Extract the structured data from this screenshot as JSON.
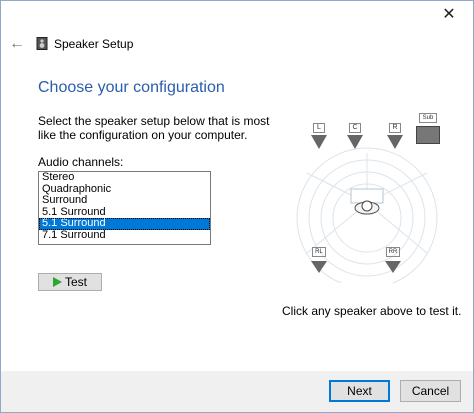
{
  "window": {
    "title": "Speaker Setup",
    "close_glyph": "✕",
    "back_glyph": "←"
  },
  "main": {
    "heading": "Choose your configuration",
    "description": "Select the speaker setup below that is most like the configuration on your computer.",
    "channels_label": "Audio channels:",
    "channels": [
      "Stereo",
      "Quadraphonic",
      "Surround",
      "5.1 Surround",
      "5.1 Surround",
      "7.1 Surround"
    ],
    "selected_index": 4,
    "test_label": "Test",
    "hint": "Click any speaker above to test it."
  },
  "speakers": {
    "front_left": "L",
    "center": "C",
    "front_right": "R",
    "subwoofer": "Sub",
    "rear_left": "RL",
    "rear_right": "RR"
  },
  "footer": {
    "next_label": "Next",
    "cancel_label": "Cancel"
  },
  "colors": {
    "accent": "#0078d7",
    "heading": "#2a5dae",
    "play": "#2da629"
  }
}
